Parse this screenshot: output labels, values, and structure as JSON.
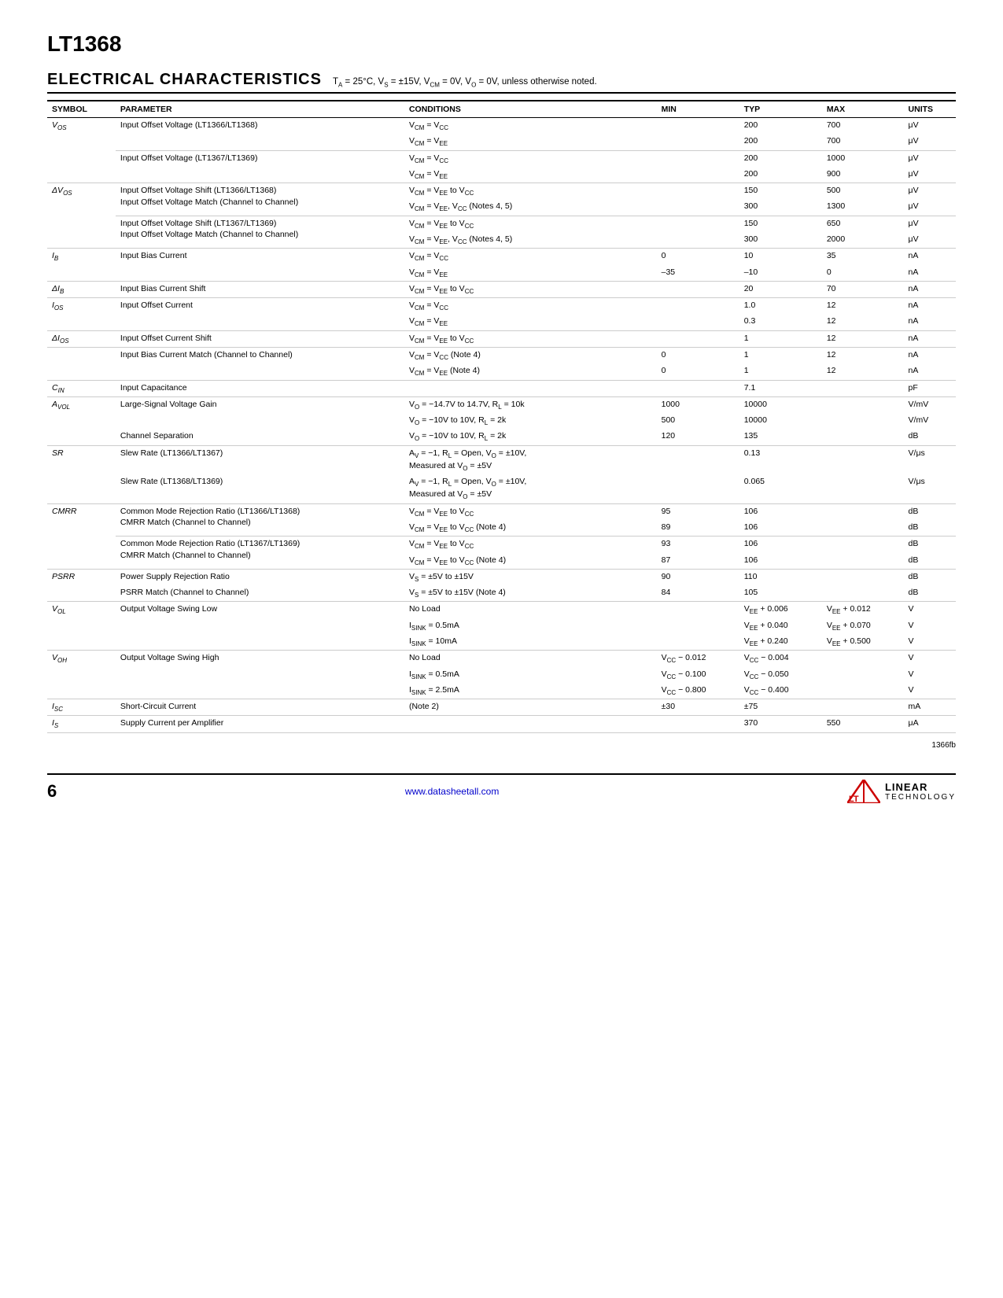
{
  "page": {
    "title": "LT1368",
    "section_title": "ELECTRICAL CHARACTERISTICS",
    "section_subtitle": "Tₐ = 25°C, Vₛ = ±15V, V⁃ₘ = 0V, Vₒ = 0V, unless otherwise noted.",
    "doc_ref": "1366fb",
    "page_number": "6",
    "footer_url": "www.datasheetall.com",
    "logo_lt": "LT",
    "logo_linear": "LINEAR",
    "logo_technology": "TECHNOLOGY"
  },
  "table": {
    "headers": [
      "SYMBOL",
      "PARAMETER",
      "CONDITIONS",
      "MIN",
      "TYP",
      "MAX",
      "UNITS"
    ],
    "rows": []
  }
}
